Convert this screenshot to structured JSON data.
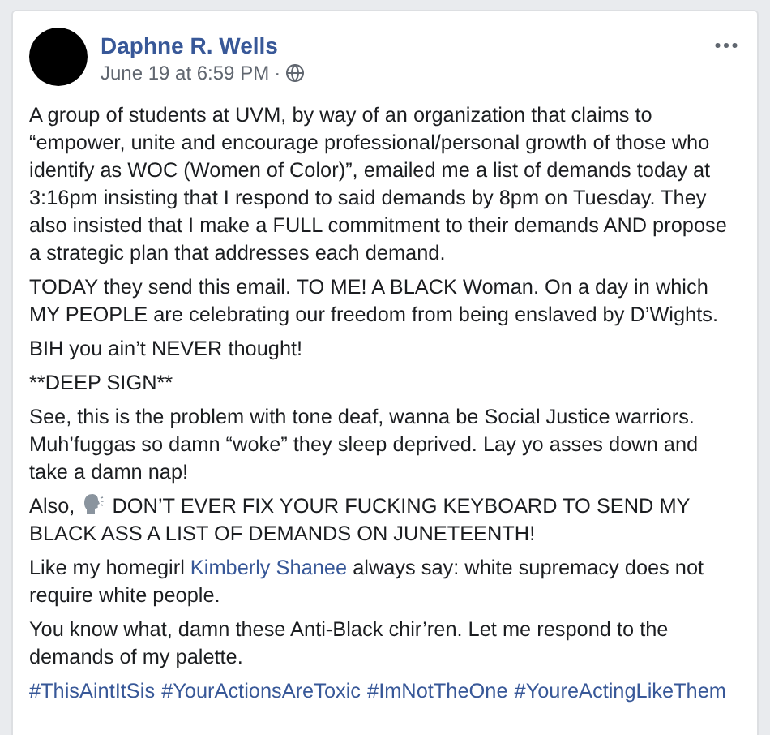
{
  "post": {
    "author": "Daphne R. Wells",
    "timestamp": "June 19 at 6:59 PM",
    "separator": "·",
    "paragraphs": [
      [
        {
          "kind": "text",
          "text": "A group of students at UVM, by way of an organization that claims to “empower, unite and encourage professional/personal growth of those who identify as WOC (Women of Color)”, emailed me a list of demands today at 3:16pm insisting that I respond to said demands by 8pm on Tuesday. They also insisted that I make a FULL commitment to their demands AND propose a strategic plan that addresses each demand."
        }
      ],
      [
        {
          "kind": "text",
          "text": "TODAY they send this email. TO ME! A BLACK Woman. On a day in which MY PEOPLE are celebrating our freedom from being enslaved by D’Wights."
        }
      ],
      [
        {
          "kind": "text",
          "text": "BIH you ain’t NEVER thought!"
        }
      ],
      [
        {
          "kind": "text",
          "text": "**DEEP SIGN**"
        }
      ],
      [
        {
          "kind": "text",
          "text": "See, this is the problem with tone deaf, wanna be Social Justice warriors. Muh’fuggas so damn “woke” they sleep deprived. Lay yo asses down and take a damn nap!"
        }
      ],
      [
        {
          "kind": "text",
          "text": "Also, "
        },
        {
          "kind": "emoji"
        },
        {
          "kind": "text",
          "text": " DON’T EVER FIX YOUR FUCKING KEYBOARD TO SEND MY BLACK ASS A LIST OF DEMANDS ON JUNETEENTH!"
        }
      ],
      [
        {
          "kind": "text",
          "text": "Like my homegirl "
        },
        {
          "kind": "link",
          "text": "Kimberly Shanee"
        },
        {
          "kind": "text",
          "text": " always say: white supremacy does not require white people."
        }
      ],
      [
        {
          "kind": "text",
          "text": "You know what, damn these Anti-Black chir’ren. Let me respond to the demands of my palette."
        }
      ]
    ],
    "hashtags": [
      "#ThisAintItSis",
      "#YourActionsAreToxic",
      "#ImNotTheOne",
      "#YoureActingLikeThem"
    ]
  }
}
